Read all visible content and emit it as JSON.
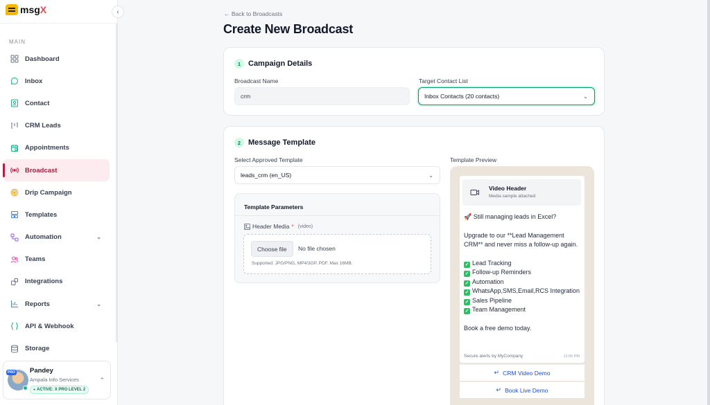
{
  "brand": {
    "name": "msg",
    "accent": "X"
  },
  "sidebar": {
    "section": "MAIN",
    "items": [
      {
        "label": "Dashboard",
        "icon": "grid-icon"
      },
      {
        "label": "Inbox",
        "icon": "chat-bubble-icon"
      },
      {
        "label": "Contact",
        "icon": "contact-card-icon"
      },
      {
        "label": "CRM Leads",
        "icon": "columns-icon"
      },
      {
        "label": "Appointments",
        "icon": "calendar-icon"
      },
      {
        "label": "Broadcast",
        "icon": "broadcast-icon",
        "active": true
      },
      {
        "label": "Drip Campaign",
        "icon": "target-icon"
      },
      {
        "label": "Templates",
        "icon": "templates-icon"
      },
      {
        "label": "Automation",
        "icon": "automation-icon",
        "expandable": true
      },
      {
        "label": "Teams",
        "icon": "users-icon"
      },
      {
        "label": "Integrations",
        "icon": "puzzle-icon"
      },
      {
        "label": "Reports",
        "icon": "bar-chart-icon",
        "expandable": true
      },
      {
        "label": "API & Webhook",
        "icon": "code-braces-icon"
      },
      {
        "label": "Storage",
        "icon": "database-icon"
      }
    ]
  },
  "user": {
    "badge": "PRO",
    "name": "Pandey",
    "company": "Ampala Info Services",
    "plan": "ACTIVE: X PRO LEVEL 2"
  },
  "header": {
    "back": "Back to Broadcasts",
    "title": "Create New Broadcast"
  },
  "campaign": {
    "step": "1",
    "title": "Campaign Details",
    "name_label": "Broadcast Name",
    "name_value": "crm",
    "list_label": "Target Contact List",
    "list_value": "Inbox Contacts (20 contacts)"
  },
  "template": {
    "step": "2",
    "title": "Message Template",
    "select_label": "Select Approved Template",
    "select_value": "leads_crm (en_US)",
    "params_title": "Template Parameters",
    "header_media_label": "Header Media",
    "required_mark": "*",
    "header_media_type": "(video)",
    "choose_file": "Choose file",
    "no_file": "No file chosen",
    "supported": "Supported: JPG/PNG, MP4/3GP, PDF. Max 16MB."
  },
  "preview": {
    "label": "Template Preview",
    "video_title": "Video Header",
    "video_sub": "Media sample attached",
    "line1": "🚀 Still managing leads in Excel?",
    "line2": "Upgrade to our **Lead Management CRM** and never miss a follow-up again.",
    "features": [
      "Lead Tracking",
      "Follow-up Reminders",
      "Automation",
      "WhatsApp,SMS,Email,RCS Integration",
      "Sales Pipeline",
      "Team Management"
    ],
    "closing": "Book a free demo today.",
    "footer": "Secure alerts by MyCompany",
    "time": "12:06 PM",
    "buttons": [
      "CRM Video Demo",
      "Book Live Demo"
    ]
  },
  "colors": {
    "accent": "#059669",
    "active_nav_bg": "#fdecef",
    "active_nav_text": "#9f1d3a",
    "link": "#1d4ed8"
  }
}
